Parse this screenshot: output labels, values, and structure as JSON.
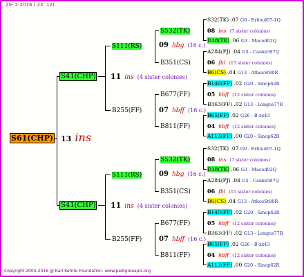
{
  "header": "20-  2-2016 ( 22: 12)",
  "footer": "Copyright 2004-2016 @ Karl Kehrle Foundation.   www.pedigreeapis.org",
  "root": {
    "code": "S61(CHP)",
    "year": "13",
    "ins": "ins"
  },
  "colors": {
    "border": "#d400d4",
    "orange": "#ff9900",
    "green": "#33ff33",
    "yellow": "#ffff00",
    "cyan": "#00ffff",
    "ins": "#cc0000",
    "sister": "#6a0dad"
  },
  "nodes": [
    {
      "code": "S41(CHP)",
      "hl": "green",
      "size": "lg",
      "year": "11",
      "ins": "ins",
      "sister": "(4 sister colonies)"
    },
    {
      "code": "S111(RS)",
      "hl": "green",
      "size": "md",
      "year": "09",
      "ins": "hbg",
      "sister": "(16 c.)"
    },
    {
      "code": "B255(FF)",
      "hl": "",
      "size": "md",
      "year": "07",
      "ins": "hbff",
      "sister": "(16 c.)"
    },
    {
      "code": "S532(TK)",
      "hl": "green",
      "size": "md",
      "year": "08",
      "ins": "ins",
      "sister": "(7 sister colonies)"
    },
    {
      "code": "B351(CS)",
      "hl": "",
      "size": "md",
      "year": "06",
      "ins": "fbl",
      "sister": "(15 sister colonies)"
    },
    {
      "code": "B677(FF)",
      "hl": "",
      "size": "md",
      "year": "05",
      "ins": "hbff",
      "sister": "(12 sister colonies)"
    },
    {
      "code": "B811(FF)",
      "hl": "",
      "size": "md",
      "year": "04",
      "ins": "hbff",
      "sister": "(12 sister colonies)"
    },
    {
      "code": "S32(TK)",
      "hl": "",
      "year": ".07",
      "loc": "G0 - Erfoud07-1Q"
    },
    {
      "code": "D18(TK)",
      "hl": "green",
      "year": ".06",
      "loc": "G3 - Maced02Q"
    },
    {
      "code": "A284(PJ)",
      "hl": "",
      "year": ".04",
      "loc": "G5 - Cankiri97Q"
    },
    {
      "code": "B6(CS)",
      "hl": "yellow",
      "year": ".04",
      "loc": "G13 - AthosSt80R"
    },
    {
      "code": "B140(FF)",
      "hl": "cyan",
      "year": ".02",
      "loc": "G20 - Sinop62R"
    },
    {
      "code": "B363(FF)",
      "hl": "",
      "year": ".02",
      "loc": "G13 - Longos77R"
    },
    {
      "code": "B65(FF)",
      "hl": "cyan",
      "year": ".02",
      "loc": "G26 - B-xx43"
    },
    {
      "code": "A113(FF)",
      "hl": "cyan",
      "year": ".00",
      "loc": "G20 - Sinop62R"
    }
  ]
}
